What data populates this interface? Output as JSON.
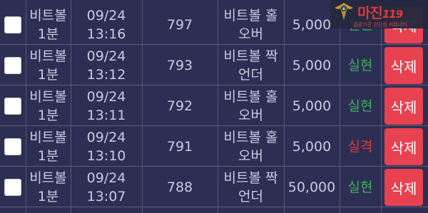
{
  "rows": [
    {
      "game_l1": "비트볼",
      "game_l2": "1분",
      "date": "09/24",
      "time": "13:16",
      "round": "797",
      "pick_l1": "비트볼 홀",
      "pick_l2": "오버",
      "amount": "5,000",
      "result": "실현",
      "result_status": "win",
      "delete_label": "삭제"
    },
    {
      "game_l1": "비트볼",
      "game_l2": "1분",
      "date": "09/24",
      "time": "13:12",
      "round": "793",
      "pick_l1": "비트볼 짝",
      "pick_l2": "언더",
      "amount": "5,000",
      "result": "실현",
      "result_status": "win",
      "delete_label": "삭제"
    },
    {
      "game_l1": "비트볼",
      "game_l2": "1분",
      "date": "09/24",
      "time": "13:11",
      "round": "792",
      "pick_l1": "비트볼 홀",
      "pick_l2": "오버",
      "amount": "5,000",
      "result": "실현",
      "result_status": "win",
      "delete_label": "삭제"
    },
    {
      "game_l1": "비트볼",
      "game_l2": "1분",
      "date": "09/24",
      "time": "13:10",
      "round": "791",
      "pick_l1": "비트볼 홀",
      "pick_l2": "오버",
      "amount": "5,000",
      "result": "실격",
      "result_status": "lose",
      "delete_label": "삭제"
    },
    {
      "game_l1": "비트볼",
      "game_l2": "1분",
      "date": "09/24",
      "time": "13:07",
      "round": "788",
      "pick_l1": "비트볼 짝",
      "pick_l2": "언더",
      "amount": "50,000",
      "result": "실현",
      "result_status": "win",
      "delete_label": "삭제"
    }
  ],
  "watermark": {
    "title": "마진",
    "suffix": "119",
    "subtitle": "검증기관 안전한 커뮤니티"
  },
  "colors": {
    "background": "#2c2f53",
    "win": "#3fae5b",
    "lose": "#e03a3a",
    "delete_button": "#e8414f"
  }
}
